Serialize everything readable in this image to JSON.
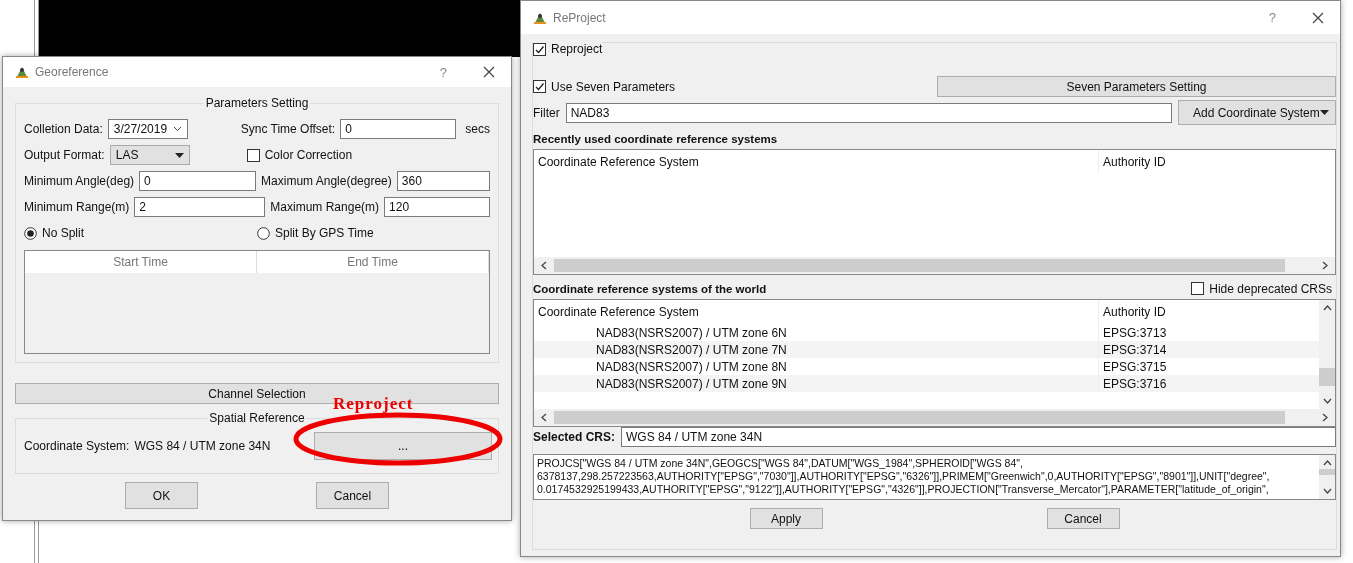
{
  "georeference": {
    "title": "Georeference",
    "help": "?",
    "parameters": {
      "title": "Parameters Setting",
      "collection_date": {
        "label": "Colletion Data:",
        "value": "3/27/2019"
      },
      "sync_offset": {
        "label": "Sync Time Offset:",
        "value": "0",
        "unit": "secs"
      },
      "output_format": {
        "label": "Output Format:",
        "value": "LAS"
      },
      "color_correction": {
        "label": "Color Correction",
        "checked": false
      },
      "min_angle": {
        "label": "Minimum Angle(deg)",
        "value": "0"
      },
      "max_angle": {
        "label": "Maximum Angle(degree)",
        "value": "360"
      },
      "min_range": {
        "label": "Minimum Range(m)",
        "value": "2"
      },
      "max_range": {
        "label": "Maximum Range(m)",
        "value": "120"
      },
      "split_options": [
        {
          "label": "No Split",
          "selected": true
        },
        {
          "label": "Split By GPS Time",
          "selected": false
        }
      ],
      "table_columns": [
        "Start Time",
        "End Time"
      ]
    },
    "channel_button": "Channel Selection",
    "spatial": {
      "title": "Spatial Reference",
      "label": "Coordinate System:",
      "value": "WGS 84 / UTM zone 34N",
      "browse_button": "..."
    },
    "buttons": [
      "OK",
      "Cancel"
    ]
  },
  "annotation": {
    "text": "Reproject"
  },
  "reproject": {
    "title": "ReProject",
    "help": "?",
    "reproject_check": {
      "label": "Reproject",
      "checked": true
    },
    "seven_params": {
      "label": "Use Seven Parameters",
      "checked": true
    },
    "seven_params_button": "Seven Parameters Setting",
    "filter": {
      "label": "Filter",
      "value": "NAD83"
    },
    "add_button": "Add Coordinate System",
    "recent": {
      "title": "Recently used coordinate reference systems",
      "columns": [
        "Coordinate Reference System",
        "Authority ID"
      ]
    },
    "world": {
      "title": "Coordinate reference systems of the world",
      "hide_deprecated": {
        "label": "Hide deprecated CRSs",
        "checked": false
      },
      "columns": [
        "Coordinate Reference System",
        "Authority ID"
      ],
      "rows": [
        {
          "name": "NAD83(NSRS2007) / UTM zone 6N",
          "id": "EPSG:3713"
        },
        {
          "name": "NAD83(NSRS2007) / UTM zone 7N",
          "id": "EPSG:3714"
        },
        {
          "name": "NAD83(NSRS2007) / UTM zone 8N",
          "id": "EPSG:3715"
        },
        {
          "name": "NAD83(NSRS2007) / UTM zone 9N",
          "id": "EPSG:3716"
        }
      ]
    },
    "selected_crs": {
      "label": "Selected CRS:",
      "value": "WGS 84 / UTM zone 34N"
    },
    "wkt": [
      "PROJCS[\"WGS 84 / UTM zone 34N\",GEOGCS[\"WGS 84\",DATUM[\"WGS_1984\",SPHEROID[\"WGS 84\",",
      "6378137,298.257223563,AUTHORITY[\"EPSG\",\"7030\"]],AUTHORITY[\"EPSG\",\"6326\"]],PRIMEM[\"Greenwich\",0,AUTHORITY[\"EPSG\",\"8901\"]],UNIT[\"degree\",",
      "0.0174532925199433,AUTHORITY[\"EPSG\",\"9122\"]],AUTHORITY[\"EPSG\",\"4326\"]],PROJECTION[\"Transverse_Mercator\"],PARAMETER[\"latitude_of_origin\","
    ],
    "buttons": [
      "Apply",
      "Cancel"
    ]
  }
}
